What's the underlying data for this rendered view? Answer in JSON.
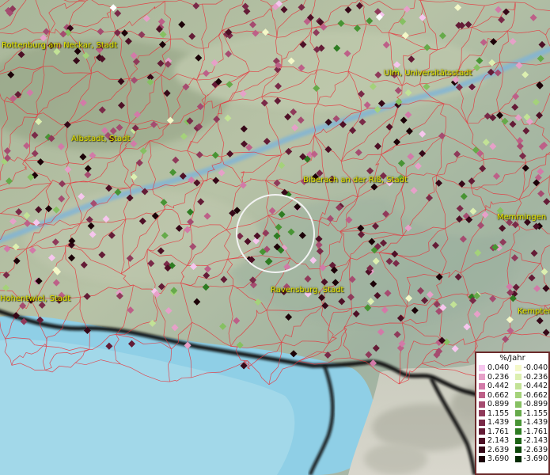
{
  "map": {
    "places": [
      {
        "name": "Rottenburg am Neckar, Stadt"
      },
      {
        "name": "Ulm, Universitätsstadt"
      },
      {
        "name": "Albstadt, Stadt"
      },
      {
        "name": "Biberach an der Riß, Stadt"
      },
      {
        "name": "Memmingen"
      },
      {
        "name": "Hohentwiel, Stadt"
      },
      {
        "name": "Ravensburg, Stadt"
      },
      {
        "name": "Kempten"
      }
    ]
  },
  "legend": {
    "title": "%/Jahr",
    "positive": [
      {
        "label": "0.040",
        "color": "#f6c6ee"
      },
      {
        "label": "0.236",
        "color": "#e6a0c8"
      },
      {
        "label": "0.442",
        "color": "#d27aa8"
      },
      {
        "label": "0.662",
        "color": "#bd6088"
      },
      {
        "label": "0.899",
        "color": "#a54c70"
      },
      {
        "label": "1.155",
        "color": "#8f3a5a"
      },
      {
        "label": "1.439",
        "color": "#7a2a48"
      },
      {
        "label": "1.761",
        "color": "#641c36"
      },
      {
        "label": "2.143",
        "color": "#4e1026"
      },
      {
        "label": "2.639",
        "color": "#360818"
      },
      {
        "label": "3.690",
        "color": "#1c0208"
      }
    ],
    "negative": [
      {
        "label": "-0.040",
        "color": "#f4f8c8"
      },
      {
        "label": "-0.236",
        "color": "#dcefb0"
      },
      {
        "label": "-0.442",
        "color": "#c2e296"
      },
      {
        "label": "-0.662",
        "color": "#a4d27a"
      },
      {
        "label": "-0.899",
        "color": "#86c062"
      },
      {
        "label": "-1.155",
        "color": "#66aa4a"
      },
      {
        "label": "-1.439",
        "color": "#489434"
      },
      {
        "label": "-1.761",
        "color": "#2e7c22"
      },
      {
        "label": "-2.143",
        "color": "#1c6214"
      },
      {
        "label": "-2.639",
        "color": "#0e460a"
      },
      {
        "label": "-3.690",
        "color": "#042a02"
      }
    ]
  }
}
